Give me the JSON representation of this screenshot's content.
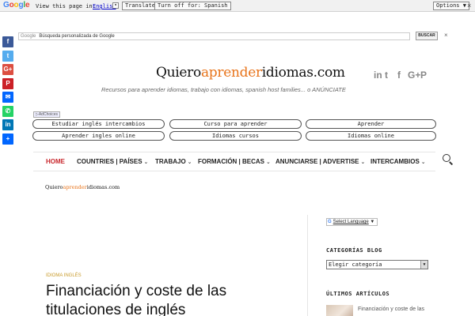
{
  "translate_bar": {
    "logo": [
      "G",
      "o",
      "o",
      "g",
      "l",
      "e"
    ],
    "label": "View this page in:",
    "language": "English",
    "language_arrow": "▾",
    "translate_button": "Translate",
    "turn_off_button": "Turn off for: Spanish",
    "options_button": "Options ▼",
    "close": "×"
  },
  "share": [
    {
      "name": "facebook-icon",
      "glyph": "f",
      "color": "#3b5998"
    },
    {
      "name": "twitter-icon",
      "glyph": "t",
      "color": "#55acee"
    },
    {
      "name": "google-plus-icon",
      "glyph": "G+",
      "color": "#dc4e41"
    },
    {
      "name": "pinterest-icon",
      "glyph": "P",
      "color": "#cb2027"
    },
    {
      "name": "email-icon",
      "glyph": "✉",
      "color": "#0166ff"
    },
    {
      "name": "whatsapp-icon",
      "glyph": "✆",
      "color": "#25d366"
    },
    {
      "name": "linkedin-icon",
      "glyph": "in",
      "color": "#0077b5"
    },
    {
      "name": "share-icon",
      "glyph": "+",
      "color": "#0166ff"
    }
  ],
  "search": {
    "google_label": "Google",
    "placeholder": "Búsqueda personalizada de Google",
    "button": "BUSCAR",
    "clear": "×"
  },
  "header": {
    "logo_left": "Quiero",
    "logo_mid": "aprender",
    "logo_right": "idiomas.com",
    "social": [
      {
        "name": "linkedin-icon",
        "glyph": "in"
      },
      {
        "name": "twitter-icon",
        "glyph": "t"
      },
      {
        "name": "facebook-icon",
        "glyph": "f"
      },
      {
        "name": "google-plus-icon",
        "glyph": "G+"
      },
      {
        "name": "pinterest-icon",
        "glyph": "P"
      }
    ],
    "tagline": "Recursos para aprender idiomas, trabajo con idiomas, spanish host families... o ANÚNCIATE"
  },
  "ads": {
    "adchoices": "▷AdChoices",
    "links": [
      "Estudiar inglés intercambios",
      "Curso para aprender",
      "Aprender",
      "Aprender ingles online",
      "Idiomas cursos",
      "Idiomas online"
    ]
  },
  "nav": {
    "items": [
      {
        "label": "HOME",
        "chev": ""
      },
      {
        "label": "COUNTRIES | PAÍSES",
        "chev": "⌄"
      },
      {
        "label": "TRABAJO",
        "chev": "⌄"
      },
      {
        "label": "FORMACIÓN | BECAS",
        "chev": "⌄"
      },
      {
        "label": "ANUNCIARSE | ADVERTISE",
        "chev": "⌄"
      },
      {
        "label": "INTERCAMBIOS",
        "chev": "⌄"
      }
    ]
  },
  "small_logo": {
    "left": "Quiero",
    "mid": "aprender",
    "right": "idiomas.com"
  },
  "article": {
    "category": "IDIOMA INGLÉS",
    "title": "Financiación y coste de las titulaciones de inglés"
  },
  "sidebar": {
    "translate_g": "G",
    "translate_label": "Select Language",
    "translate_arrow": "▼",
    "categories_heading": "CATEGORÍAS BLOG",
    "categories_select": "Elegir categoría",
    "select_arrow": "▼",
    "recent_heading": "ÚLTIMOS ARTÍCULOS",
    "recent_first": "Financiación y coste de las"
  }
}
